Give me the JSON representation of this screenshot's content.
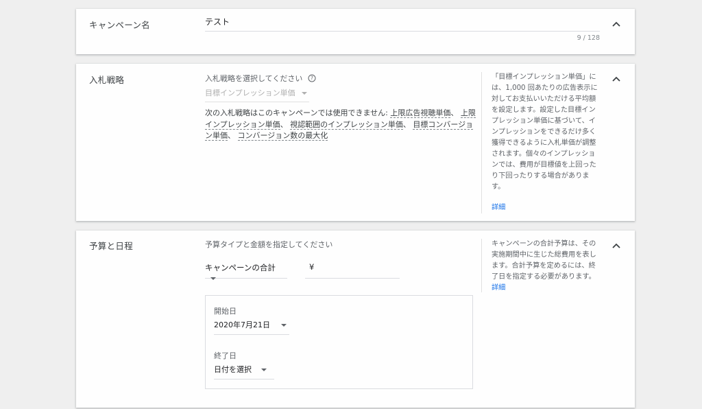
{
  "campaign_name": {
    "title": "キャンペーン名",
    "value": "テスト",
    "counter": "9 / 128"
  },
  "bidding": {
    "title": "入札戦略",
    "select_label": "入札戦略を選択してください",
    "selected_strategy": "目標インプレッション単価",
    "unavailable_prefix": "次の入札戦略はこのキャンペーンでは使用できません:",
    "unavailable": [
      "上限広告視聴単価",
      "上限インプレッション単価",
      "視認範囲のインプレッション単価",
      "目標コンバージョン単価",
      "コンバージョン数の最大化"
    ],
    "separator": "、",
    "help_text": "「目標インプレッション単価」には、1,000 回あたりの広告表示に対してお支払いいただける平均額を設定します。設定した目標インプレッション単価に基づいて、インプレッションをできるだけ多く獲得できるように入札単価が調整されます。個々のインプレッションでは、費用が目標値を上回ったり下回ったりする場合があります。",
    "help_link": "詳細"
  },
  "budget": {
    "title": "予算と日程",
    "instruction": "予算タイプと金額を指定してください",
    "budget_type": "キャンペーンの合計",
    "currency": "¥",
    "amount": "",
    "start_label": "開始日",
    "start_value": "2020年7月21日",
    "end_label": "終了日",
    "end_value": "日付を選択",
    "help_text": "キャンペーンの合計予算は、その実施期間中に生じた総費用を表します。合計予算を定めるには、終了日を指定する必要があります。",
    "help_link": "詳細"
  },
  "icons": {
    "collapse": "chevron-up-icon",
    "help": "help-circle-icon",
    "dropdown": "arrow-drop-down-icon"
  },
  "colors": {
    "link": "#1a73e8",
    "background": "#efefef",
    "card": "#fefefe"
  }
}
